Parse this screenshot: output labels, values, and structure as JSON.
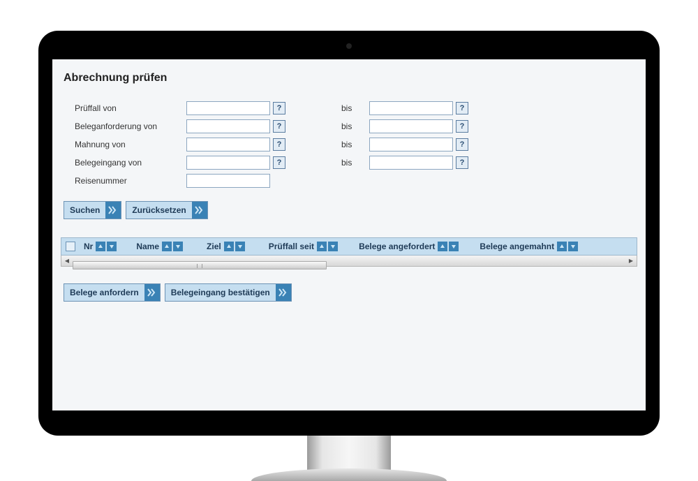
{
  "page_title": "Abrechnung prüfen",
  "filters": {
    "rows": [
      {
        "label_from": "Prüffall von",
        "val_from": "",
        "has_to": true,
        "label_to": "bis",
        "val_to": ""
      },
      {
        "label_from": "Beleganforderung von",
        "val_from": "",
        "has_to": true,
        "label_to": "bis",
        "val_to": ""
      },
      {
        "label_from": "Mahnung von",
        "val_from": "",
        "has_to": true,
        "label_to": "bis",
        "val_to": ""
      },
      {
        "label_from": "Belegeingang von",
        "val_from": "",
        "has_to": true,
        "label_to": "bis",
        "val_to": ""
      },
      {
        "label_from": "Reisenummer",
        "val_from": "",
        "has_to": false
      }
    ],
    "help_icon": "?"
  },
  "buttons": {
    "search": "Suchen",
    "reset": "Zurücksetzen",
    "request_docs": "Belege anfordern",
    "confirm_docs": "Belegeingang bestätigen"
  },
  "table": {
    "columns": [
      {
        "label": "Nr"
      },
      {
        "label": "Name"
      },
      {
        "label": "Ziel"
      },
      {
        "label": "Prüffall seit"
      },
      {
        "label": "Belege angefordert"
      },
      {
        "label": "Belege angemahnt"
      }
    ]
  }
}
